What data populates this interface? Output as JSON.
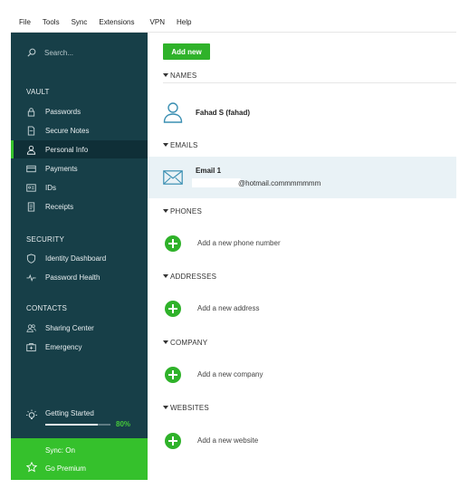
{
  "menubar": {
    "items": [
      "File",
      "Tools",
      "Sync",
      "Extensions",
      "VPN",
      "Help"
    ]
  },
  "sidebar": {
    "search_placeholder": "Search...",
    "sections": {
      "vault": "VAULT",
      "security": "SECURITY",
      "contacts": "CONTACTS"
    },
    "items": [
      {
        "label": "Passwords",
        "icon": "lock-icon"
      },
      {
        "label": "Secure Notes",
        "icon": "note-icon"
      },
      {
        "label": "Personal Info",
        "icon": "person-icon",
        "active": true
      },
      {
        "label": "Payments",
        "icon": "card-icon"
      },
      {
        "label": "IDs",
        "icon": "id-card-icon"
      },
      {
        "label": "Receipts",
        "icon": "receipt-icon"
      },
      {
        "label": "Identity Dashboard",
        "icon": "shield-icon"
      },
      {
        "label": "Password Health",
        "icon": "pulse-icon"
      },
      {
        "label": "Sharing Center",
        "icon": "people-icon"
      },
      {
        "label": "Emergency",
        "icon": "medkit-icon"
      }
    ],
    "getting_started": {
      "label": "Getting Started",
      "progress_percent": 80,
      "progress_label": "80%"
    },
    "sync_status": "Sync: On",
    "premium_label": "Go Premium"
  },
  "main": {
    "add_new_label": "Add new",
    "sections": {
      "names": "NAMES",
      "emails": "EMAILS",
      "phones": "PHONES",
      "addresses": "ADDRESSES",
      "company": "COMPANY",
      "websites": "WEBSITES"
    },
    "name_entry": "Fahad S (fahad)",
    "email_entry": {
      "title": "Email 1",
      "address": "@hotmail.commmmmmm"
    },
    "add_phone": "Add a new phone number",
    "add_address": "Add a new address",
    "add_company": "Add a new company",
    "add_website": "Add a new website"
  },
  "colors": {
    "sidebar_bg": "#173f48",
    "accent_green": "#35c12c",
    "email_row_bg": "#e9f2f6"
  }
}
